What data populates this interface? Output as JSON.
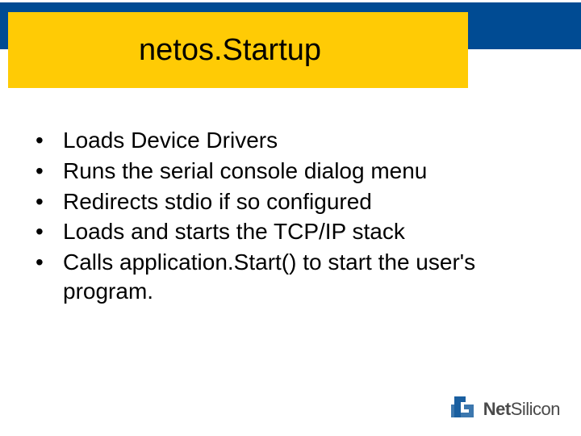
{
  "title": "netos.Startup",
  "bullets": [
    "Loads Device Drivers",
    "Runs the serial console dialog menu",
    "Redirects stdio if so configured",
    "Loads and starts the TCP/IP stack",
    "Calls application.Start() to start the user's program."
  ],
  "logo": {
    "brand_part1": "Net",
    "brand_part2": "Silicon"
  },
  "colors": {
    "blue": "#004b93",
    "yellow": "#ffcb05",
    "logo_blue": "#1a5fa0"
  }
}
